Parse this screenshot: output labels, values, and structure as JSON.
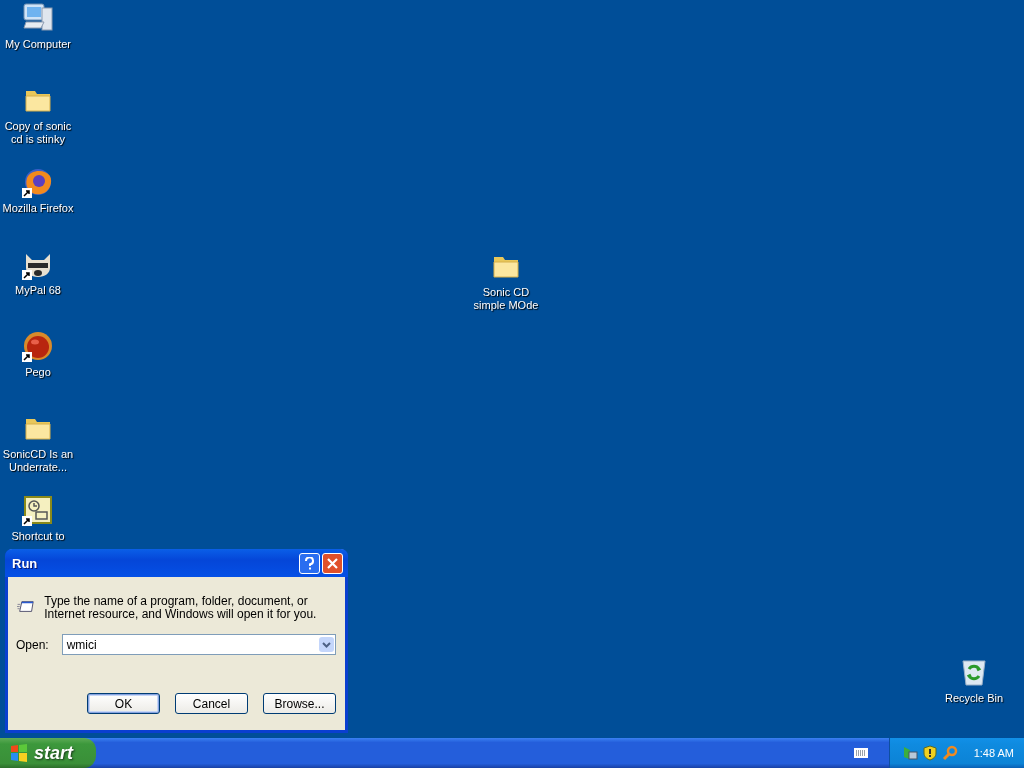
{
  "desktop_icons": [
    {
      "label": "My Computer",
      "kind": "computer",
      "shortcut": false
    },
    {
      "label": "Copy of sonic cd is stinky",
      "kind": "folder",
      "shortcut": false
    },
    {
      "label": "Mozilla Firefox",
      "kind": "browser",
      "shortcut": true
    },
    {
      "label": "MyPal 68",
      "kind": "raccoon",
      "shortcut": true
    },
    {
      "label": "Pego",
      "kind": "ball",
      "shortcut": true
    },
    {
      "label": "SonicCD Is an Underrate...",
      "kind": "folder",
      "shortcut": false
    },
    {
      "label": "Shortcut to",
      "kind": "clockdoc",
      "shortcut": true
    },
    {
      "label": "Sonic CD simple MOde",
      "kind": "folder",
      "shortcut": false
    },
    {
      "label": "Recycle Bin",
      "kind": "recycle",
      "shortcut": false
    }
  ],
  "run_dialog": {
    "title": "Run",
    "message": "Type the name of a program, folder, document, or Internet resource, and Windows will open it for you.",
    "open_label": "Open:",
    "open_value": "wmici",
    "buttons": [
      {
        "label": "OK",
        "default": true
      },
      {
        "label": "Cancel",
        "default": false
      },
      {
        "label": "Browse...",
        "default": false
      }
    ]
  },
  "taskbar": {
    "start_label": "start",
    "clock": "1:48 AM"
  }
}
